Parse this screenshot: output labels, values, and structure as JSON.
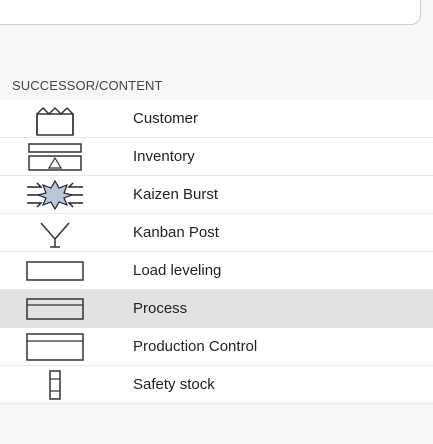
{
  "section": {
    "title": "SUCCESSOR/CONTENT"
  },
  "items": [
    {
      "label": "Customer",
      "icon": "customer-icon"
    },
    {
      "label": "Inventory",
      "icon": "inventory-icon"
    },
    {
      "label": "Kaizen Burst",
      "icon": "kaizen-burst-icon"
    },
    {
      "label": "Kanban Post",
      "icon": "kanban-post-icon"
    },
    {
      "label": "Load leveling",
      "icon": "load-leveling-icon"
    },
    {
      "label": "Process",
      "icon": "process-icon"
    },
    {
      "label": "Production Control",
      "icon": "production-control-icon"
    },
    {
      "label": "Safety stock",
      "icon": "safety-stock-icon"
    }
  ],
  "selected_index": 5
}
